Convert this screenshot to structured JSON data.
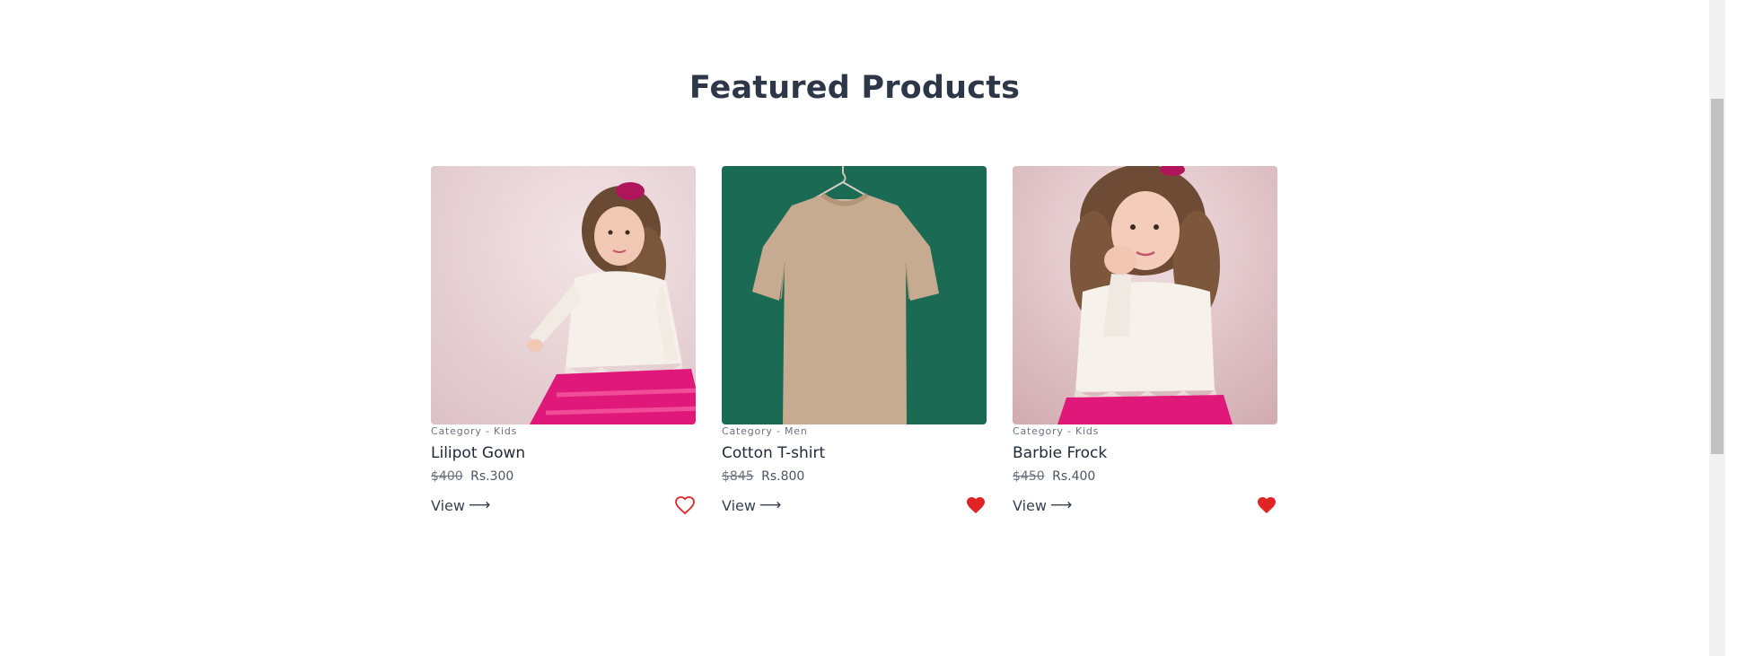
{
  "section": {
    "title": "Featured Products"
  },
  "products": [
    {
      "category": "Category - Kids",
      "name": "Lilipot Gown",
      "old_price": "$400",
      "price": "Rs.300",
      "view_label": "View",
      "favorited": false,
      "image": "girl-in-pink-dress"
    },
    {
      "category": "Category - Men",
      "name": "Cotton T-shirt",
      "old_price": "$845",
      "price": "Rs.800",
      "view_label": "View",
      "favorited": true,
      "image": "beige-tshirt-on-hanger"
    },
    {
      "category": "Category - Kids",
      "name": "Barbie Frock",
      "old_price": "$450",
      "price": "Rs.400",
      "view_label": "View",
      "favorited": true,
      "image": "girl-hand-on-cheek"
    }
  ],
  "colors": {
    "heart": "#e02424",
    "tshirt_bg": "#1b6b54",
    "kids_bg": "#ead6d9",
    "dress_pink": "#e11d74"
  },
  "icons": {
    "arrow": "arrow-right-icon",
    "heart_outline": "heart-outline-icon",
    "heart_filled": "heart-filled-icon"
  }
}
